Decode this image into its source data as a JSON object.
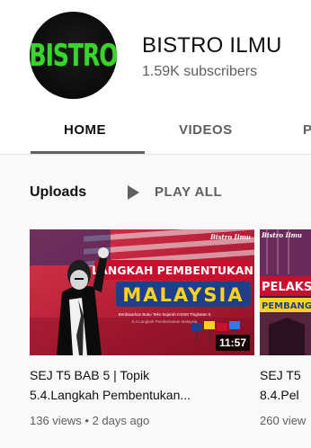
{
  "channel": {
    "avatar_text": "BISTRO",
    "name": "BISTRO ILMU",
    "subscribers": "1.59K subscribers"
  },
  "tabs": [
    {
      "label": "HOME",
      "active": true
    },
    {
      "label": "VIDEOS",
      "active": false
    },
    {
      "label": "P",
      "active": false
    }
  ],
  "section": {
    "title": "Uploads",
    "play_all": "PLAY ALL"
  },
  "videos": [
    {
      "title_line1": "SEJ T5 BAB 5 | Topik",
      "title_line2": "5.4.Langkah Pembentukan...",
      "meta": "136 views • 2 days ago",
      "duration": "11:57",
      "thumb_brand": "Bistro Ilmu",
      "thumb_heading1": "LANGKAH PEMBENTUKAN",
      "thumb_heading2": "MALAYSIA",
      "thumb_caption1": "Berdasarkan Buku Teks Sejarah KSSM Tingkatan 5",
      "thumb_caption2": "5.4.Langkah Pembentukan Malaysia"
    },
    {
      "title_line1": "SEJ T5",
      "title_line2": "8.4.Pel",
      "meta": "260 view",
      "thumb_brand": "Bistro Ilmu",
      "thumb_heading1": "PELAKS",
      "thumb_heading2": "PEMBANG"
    }
  ],
  "colors": {
    "accent_green": "#38d62b",
    "banner_red": "#c8102e",
    "secondary_text": "#606060"
  }
}
